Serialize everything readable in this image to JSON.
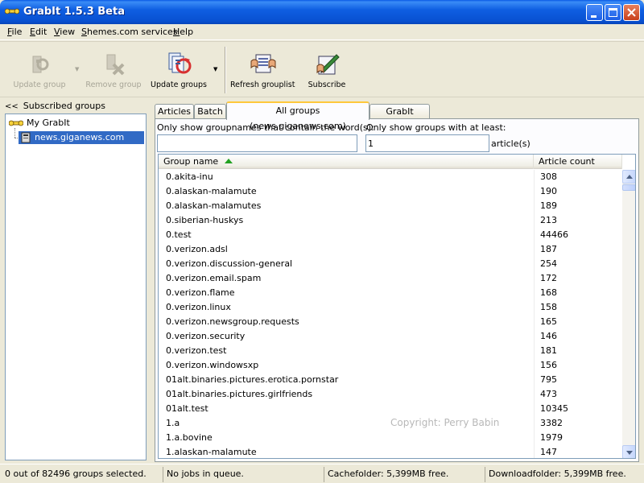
{
  "window": {
    "title": "GrabIt 1.5.3 Beta"
  },
  "menu": [
    {
      "underline": "F",
      "rest": "ile"
    },
    {
      "underline": "E",
      "rest": "dit"
    },
    {
      "underline": "V",
      "rest": "iew"
    },
    {
      "underline": "S",
      "rest": "hemes.com services"
    },
    {
      "underline": "H",
      "rest": "elp"
    }
  ],
  "toolbar": {
    "update_group": "Update group",
    "remove_group": "Remove group",
    "update_groups": "Update groups",
    "refresh_grouplist": "Refresh grouplist",
    "subscribe": "Subscribe"
  },
  "sidebar": {
    "collapse_glyph": "<<",
    "title": "Subscribed groups",
    "root": "My GrabIt",
    "server": "news.giganews.com"
  },
  "tabs": [
    {
      "label": "Articles"
    },
    {
      "label": "Batch"
    },
    {
      "label": "All groups (news.giganews.com)"
    },
    {
      "label": "GrabIt search"
    }
  ],
  "filter": {
    "name_label": "Only show groupnames that contain the word(s):",
    "name_value": "",
    "count_label": "Only show groups with at least:",
    "count_value": "1",
    "count_suffix": "article(s)"
  },
  "table": {
    "columns": [
      "Group name",
      "Article count"
    ],
    "rows": [
      [
        "0.akita-inu",
        "308"
      ],
      [
        "0.alaskan-malamute",
        "190"
      ],
      [
        "0.alaskan-malamutes",
        "189"
      ],
      [
        "0.siberian-huskys",
        "213"
      ],
      [
        "0.test",
        "44466"
      ],
      [
        "0.verizon.adsl",
        "187"
      ],
      [
        "0.verizon.discussion-general",
        "254"
      ],
      [
        "0.verizon.email.spam",
        "172"
      ],
      [
        "0.verizon.flame",
        "168"
      ],
      [
        "0.verizon.linux",
        "158"
      ],
      [
        "0.verizon.newsgroup.requests",
        "165"
      ],
      [
        "0.verizon.security",
        "146"
      ],
      [
        "0.verizon.test",
        "181"
      ],
      [
        "0.verizon.windowsxp",
        "156"
      ],
      [
        "01alt.binaries.pictures.erotica.pornstar",
        "795"
      ],
      [
        "01alt.binaries.pictures.girlfriends",
        "473"
      ],
      [
        "01alt.test",
        "10345"
      ],
      [
        "1.a",
        "3382"
      ],
      [
        "1.a.bovine",
        "1979"
      ],
      [
        "1.alaskan-malamute",
        "147"
      ]
    ],
    "watermark": "Copyright: Perry Babin"
  },
  "status": {
    "selection": "0 out of 82496 groups selected.",
    "jobs": "No jobs in queue.",
    "cache": "Cachefolder: 5,399MB free.",
    "download": "Downloadfolder: 5,399MB free."
  },
  "colors": {
    "titlebar": "#0a5ae6",
    "selection": "#316ac5",
    "active_tab_accent": "#ffc83c",
    "sort_arrow": "#21a121"
  }
}
